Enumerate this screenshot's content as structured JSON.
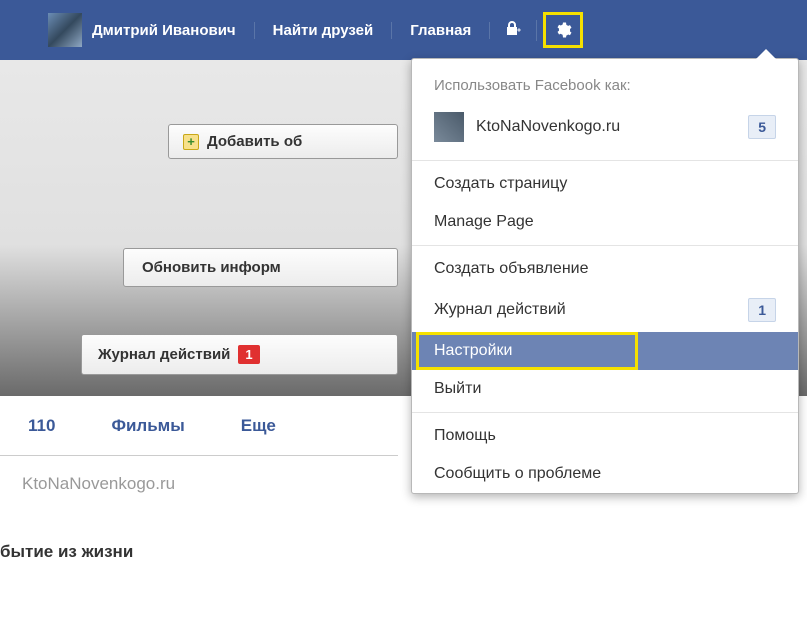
{
  "topbar": {
    "username": "Дмитрий Иванович",
    "find_friends": "Найти друзей",
    "home": "Главная"
  },
  "buttons": {
    "add": "Добавить об",
    "update": "Обновить информ",
    "journal": "Журнал действий",
    "journal_badge": "1"
  },
  "tabs": {
    "count": "110",
    "movies": "Фильмы",
    "more": "Еще"
  },
  "watermark": "KtoNaNovenkogo.ru",
  "life_event": "бытие из жизни",
  "dropdown": {
    "use_as": "Использовать Facebook как:",
    "page_name": "KtoNaNovenkogo.ru",
    "page_badge": "5",
    "create_page": "Создать страницу",
    "manage_page": "Manage Page",
    "create_ad": "Создать объявление",
    "activity_log": "Журнал действий",
    "activity_badge": "1",
    "settings": "Настройки",
    "logout": "Выйти",
    "help": "Помощь",
    "report": "Сообщить о проблеме"
  }
}
